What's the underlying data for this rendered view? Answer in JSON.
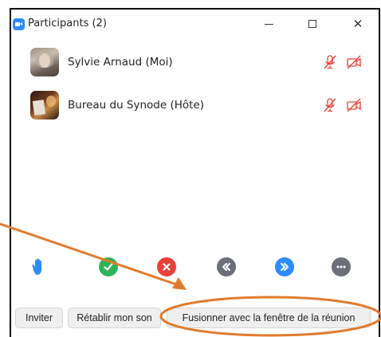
{
  "window": {
    "title": "Participants (2)",
    "app_icon": "zoom-camera-icon",
    "controls": [
      "minimize-icon",
      "maximize-icon",
      "close-icon"
    ],
    "close_glyph": "✕"
  },
  "participants": [
    {
      "name": "Sylvie Arnaud (Moi)",
      "mic": "muted",
      "video": "off",
      "avatar": "photo-woman-grey-hair"
    },
    {
      "name": "Bureau du Synode (Hôte)",
      "mic": "muted",
      "video": "off",
      "avatar": "photo-person-reading"
    }
  ],
  "reactions": [
    {
      "name": "raise-hand-icon",
      "color": "#2D8CFF"
    },
    {
      "name": "yes-check-icon",
      "color": "#2FB35A"
    },
    {
      "name": "no-x-icon",
      "color": "#E8403A"
    },
    {
      "name": "go-slower-icon",
      "color": "#6C6F78"
    },
    {
      "name": "go-faster-icon",
      "color": "#2D8CFF"
    },
    {
      "name": "more-icon",
      "color": "#6C6F78"
    }
  ],
  "buttons": {
    "invite": "Inviter",
    "unmute": "Rétablir mon son",
    "merge": "Fusionner avec la fenêtre de la réunion"
  },
  "colors": {
    "accent": "#2D8CFF",
    "muted_red": "#E8403A",
    "annotation_orange": "#E07B2E"
  }
}
